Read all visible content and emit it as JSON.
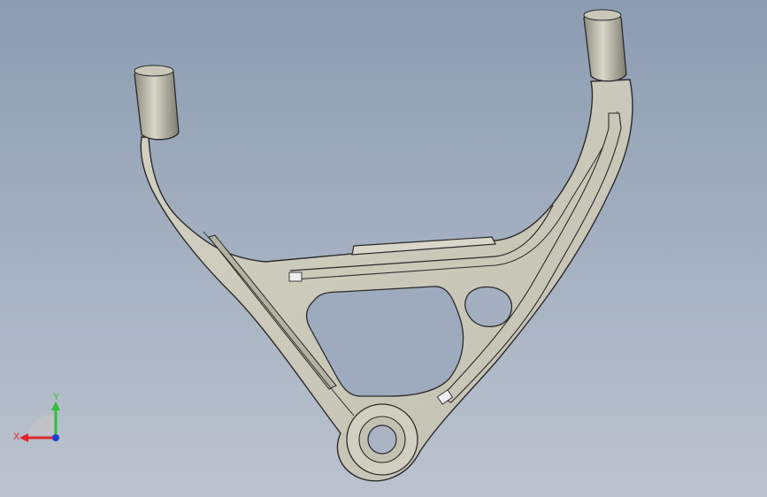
{
  "viewport": {
    "background_top": "#8c9cb1",
    "background_bottom": "#bcc3cf"
  },
  "model": {
    "name": "control-arm",
    "body_color": "#cfcdbe",
    "edge_color": "#2a2a2a",
    "shade_color": "#a9a796",
    "bushing_color": "#b9b7a8"
  },
  "triad": {
    "x_label": "X",
    "y_label": "Y",
    "x_color": "#e0262b",
    "y_color": "#2fbf3a",
    "z_color": "#1f3fd0"
  }
}
